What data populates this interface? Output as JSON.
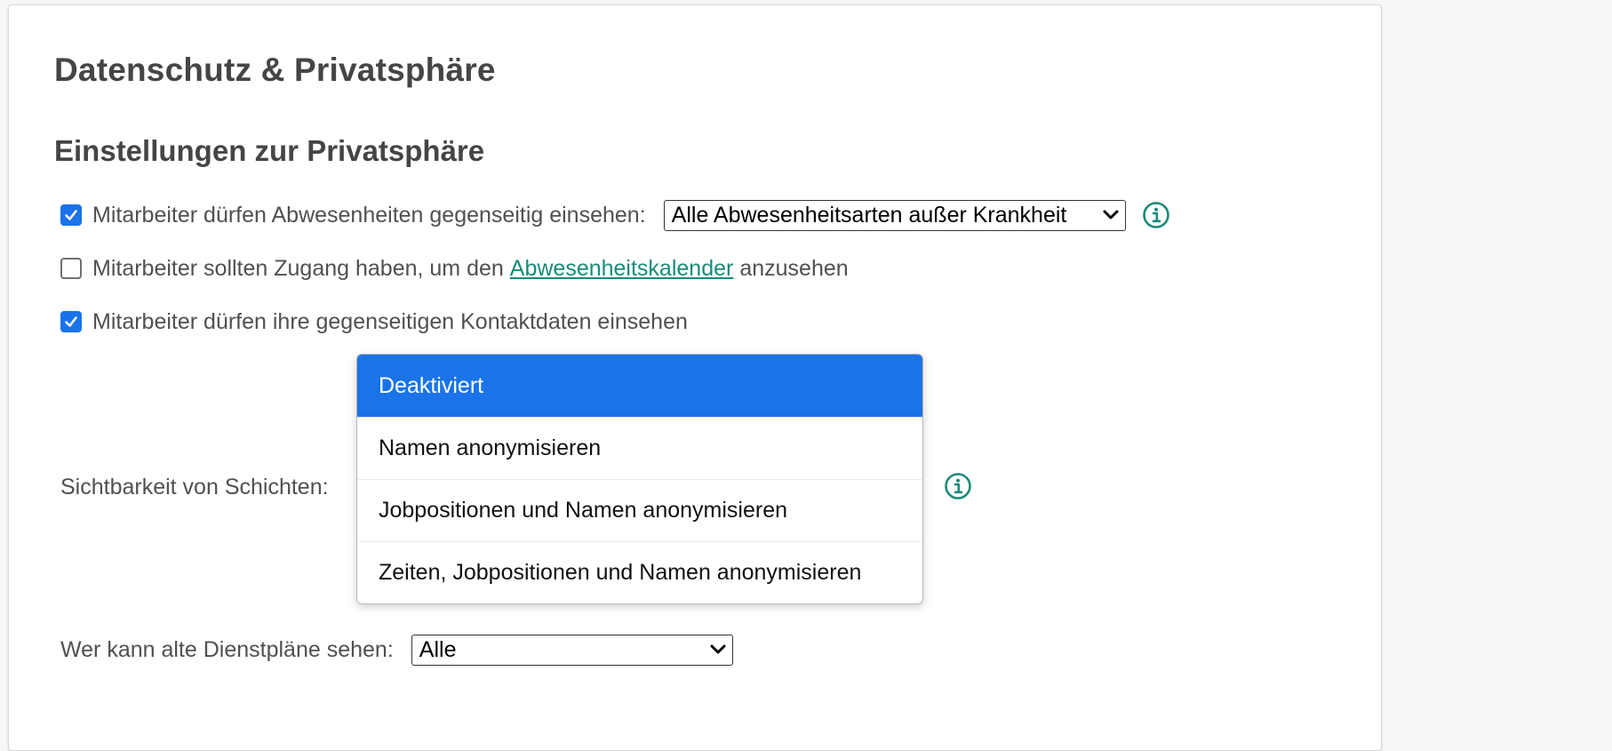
{
  "page": {
    "title": "Datenschutz & Privatsphäre"
  },
  "privacy": {
    "section_title": "Einstellungen zur Privatsphäre",
    "absences": {
      "checked": true,
      "label": "Mitarbeiter dürfen Abwesenheiten gegenseitig einsehen:",
      "select_value": "Alle Abwesenheitsarten außer Krankheit"
    },
    "calendar_access": {
      "checked": false,
      "label_before": "Mitarbeiter sollten Zugang haben, um den",
      "link_text": "Abwesenheitskalender",
      "label_after": "anzusehen"
    },
    "contact_data": {
      "checked": true,
      "label": "Mitarbeiter dürfen ihre gegenseitigen Kontaktdaten einsehen"
    },
    "shift_visibility": {
      "label": "Sichtbarkeit von Schichten:",
      "options": [
        "Deaktiviert",
        "Namen anonymisieren",
        "Jobpositionen und Namen anonymisieren",
        "Zeiten, Jobpositionen und Namen anonymisieren"
      ],
      "selected_index": 0
    },
    "old_rosters": {
      "label": "Wer kann alte Dienstpläne sehen:",
      "select_value": "Alle"
    }
  },
  "colors": {
    "accent": "#1a73e8",
    "info_icon": "#1a8a7a",
    "link": "#1a8a7a",
    "heading": "#454545"
  },
  "icons": {
    "checkbox_checked": "check-icon",
    "info": "info-icon",
    "select_arrow": "chevron-down-icon"
  }
}
